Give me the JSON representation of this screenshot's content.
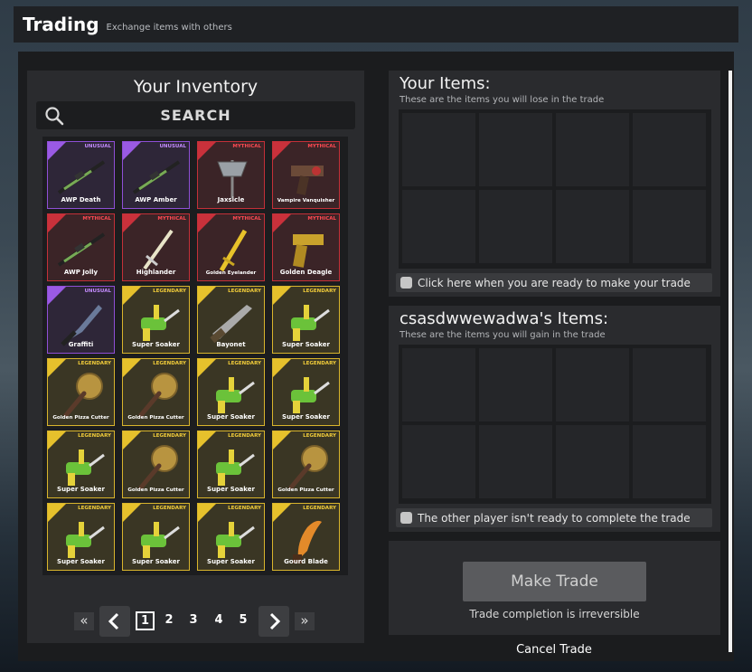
{
  "header": {
    "title": "Trading",
    "subtitle": "Exchange items with others"
  },
  "inventory": {
    "heading": "Your Inventory",
    "search_label": "SEARCH",
    "items": [
      {
        "name": "AWP Death",
        "rarity": "UNUSUAL",
        "tier": "unusual",
        "icon": "awp-rifle-icon"
      },
      {
        "name": "AWP Amber",
        "rarity": "UNUSUAL",
        "tier": "unusual",
        "icon": "awp-rifle-icon"
      },
      {
        "name": "Jaxsicle",
        "rarity": "MYTHICAL",
        "tier": "mythical",
        "icon": "axe-icon"
      },
      {
        "name": "Vampire Vanquisher",
        "rarity": "MYTHICAL",
        "tier": "mythical",
        "icon": "crossbow-pistol-icon",
        "small": true
      },
      {
        "name": "AWP Jolly",
        "rarity": "MYTHICAL",
        "tier": "mythical",
        "icon": "awp-rifle-icon"
      },
      {
        "name": "Highlander",
        "rarity": "MYTHICAL",
        "tier": "mythical",
        "icon": "sword-icon"
      },
      {
        "name": "Golden Eyelander",
        "rarity": "MYTHICAL",
        "tier": "mythical",
        "icon": "golden-sword-icon",
        "small": true
      },
      {
        "name": "Golden Deagle",
        "rarity": "MYTHICAL",
        "tier": "mythical",
        "icon": "pistol-icon"
      },
      {
        "name": "Graffiti",
        "rarity": "UNUSUAL",
        "tier": "unusual",
        "icon": "knife-icon"
      },
      {
        "name": "Super Soaker",
        "rarity": "LEGENDARY",
        "tier": "legendary",
        "icon": "water-gun-icon"
      },
      {
        "name": "Bayonet",
        "rarity": "LEGENDARY",
        "tier": "legendary",
        "icon": "bayonet-icon"
      },
      {
        "name": "Super Soaker",
        "rarity": "LEGENDARY",
        "tier": "legendary",
        "icon": "water-gun-icon"
      },
      {
        "name": "Golden Pizza Cutter",
        "rarity": "LEGENDARY",
        "tier": "legendary",
        "icon": "pizza-cutter-icon",
        "small": true
      },
      {
        "name": "Golden Pizza Cutter",
        "rarity": "LEGENDARY",
        "tier": "legendary",
        "icon": "pizza-cutter-icon",
        "small": true
      },
      {
        "name": "Super Soaker",
        "rarity": "LEGENDARY",
        "tier": "legendary",
        "icon": "water-gun-icon"
      },
      {
        "name": "Super Soaker",
        "rarity": "LEGENDARY",
        "tier": "legendary",
        "icon": "water-gun-icon"
      },
      {
        "name": "Super Soaker",
        "rarity": "LEGENDARY",
        "tier": "legendary",
        "icon": "water-gun-icon"
      },
      {
        "name": "Golden Pizza Cutter",
        "rarity": "LEGENDARY",
        "tier": "legendary",
        "icon": "pizza-cutter-icon",
        "small": true
      },
      {
        "name": "Super Soaker",
        "rarity": "LEGENDARY",
        "tier": "legendary",
        "icon": "water-gun-icon"
      },
      {
        "name": "Golden Pizza Cutter",
        "rarity": "LEGENDARY",
        "tier": "legendary",
        "icon": "pizza-cutter-icon",
        "small": true
      },
      {
        "name": "Super Soaker",
        "rarity": "LEGENDARY",
        "tier": "legendary",
        "icon": "water-gun-icon"
      },
      {
        "name": "Super Soaker",
        "rarity": "LEGENDARY",
        "tier": "legendary",
        "icon": "water-gun-icon"
      },
      {
        "name": "Super Soaker",
        "rarity": "LEGENDARY",
        "tier": "legendary",
        "icon": "water-gun-icon"
      },
      {
        "name": "Gourd Blade",
        "rarity": "LEGENDARY",
        "tier": "legendary",
        "icon": "gourd-blade-icon"
      }
    ],
    "pagination": {
      "pages": [
        "1",
        "2",
        "3",
        "4",
        "5"
      ],
      "current": "1",
      "first": "«",
      "last": "»"
    }
  },
  "your_items": {
    "heading": "Your Items:",
    "subtitle": "These are the items you will lose in the trade",
    "ready_label": "Click here when you are ready to make your trade"
  },
  "their_items": {
    "heading": "csasdwwewadwa's Items:",
    "subtitle": "These are the items you will gain in the trade",
    "ready_label": "The other player isn't ready to complete the trade"
  },
  "trade": {
    "make_trade_label": "Make Trade",
    "irreversible_note": "Trade completion is irreversible",
    "cancel_label": "Cancel Trade"
  }
}
